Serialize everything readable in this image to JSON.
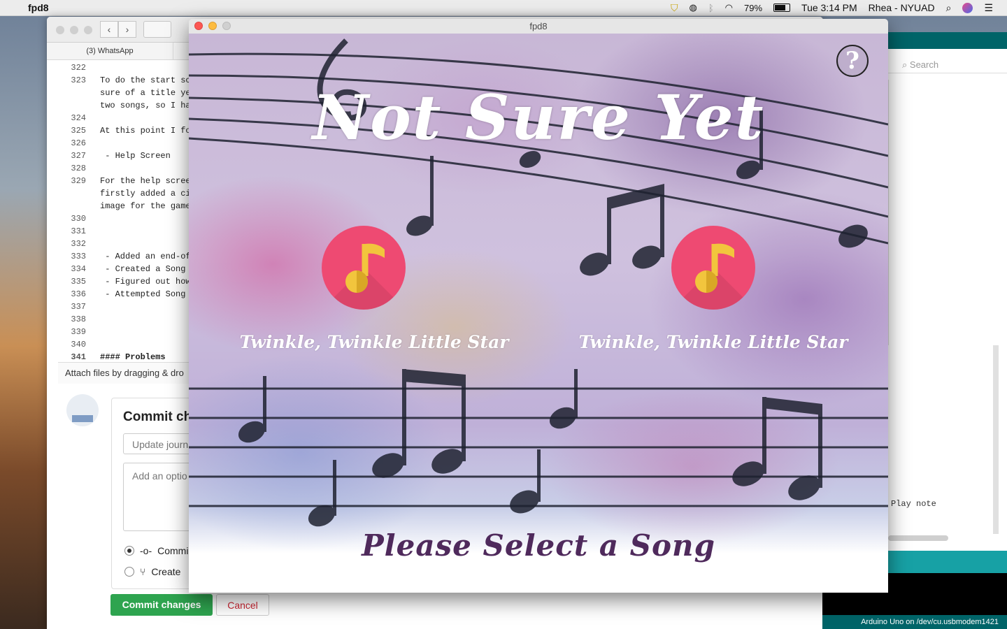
{
  "menubar": {
    "app_name": "fpd8",
    "battery": "79%",
    "clock": "Tue 3:14 PM",
    "user": "Rhea - NYUAD"
  },
  "github": {
    "tab_label": "(3) WhatsApp",
    "lines": [
      {
        "n": "322",
        "t": ""
      },
      {
        "n": "323",
        "t": "To do the start sc"
      },
      {
        "n": "",
        "t": "sure of a title ye"
      },
      {
        "n": "",
        "t": "two songs, so I ha"
      },
      {
        "n": "324",
        "t": ""
      },
      {
        "n": "325",
        "t": "At this point I fo"
      },
      {
        "n": "326",
        "t": ""
      },
      {
        "n": "327",
        "t": " - Help Screen"
      },
      {
        "n": "328",
        "t": ""
      },
      {
        "n": "329",
        "t": "For the help scree"
      },
      {
        "n": "",
        "t": "firstly added a ci"
      },
      {
        "n": "",
        "t": "image for the game"
      },
      {
        "n": "330",
        "t": ""
      },
      {
        "n": "331",
        "t": ""
      },
      {
        "n": "332",
        "t": ""
      },
      {
        "n": "333",
        "t": " - Added an end-of"
      },
      {
        "n": "334",
        "t": " - Created a Song "
      },
      {
        "n": "335",
        "t": " - Figured out how"
      },
      {
        "n": "336",
        "t": " - Attempted Song "
      },
      {
        "n": "337",
        "t": ""
      },
      {
        "n": "338",
        "t": ""
      },
      {
        "n": "339",
        "t": ""
      },
      {
        "n": "340",
        "t": ""
      },
      {
        "n": "341",
        "t": "#### Problems"
      }
    ],
    "attach_text": "Attach files by dragging & dro",
    "commit_title": "Commit ch",
    "summary_value": "Update journ",
    "description_placeholder": "Add an optio",
    "radio_commit": "Commi",
    "radio_create": "Create",
    "commit_button": "Commit changes",
    "cancel_button": "Cancel"
  },
  "arduino": {
    "search_placeholder": "Search",
    "play_note": "Play note",
    "status": "Arduino Uno on /dev/cu.usbmodem1421"
  },
  "game": {
    "window_title": "fpd8",
    "help_symbol": "?",
    "heading": "Not Sure Yet",
    "songs": [
      {
        "label": "Twinkle, Twinkle Little Star",
        "icon": "music-note-icon"
      },
      {
        "label": "Twinkle, Twinkle Little Star",
        "icon": "music-note-icon"
      }
    ],
    "prompt": "Please Select a Song",
    "colors": {
      "song_button": "#ee4a72",
      "note_icon": "#f2c53d",
      "prompt_text": "#4f2a5c"
    }
  }
}
